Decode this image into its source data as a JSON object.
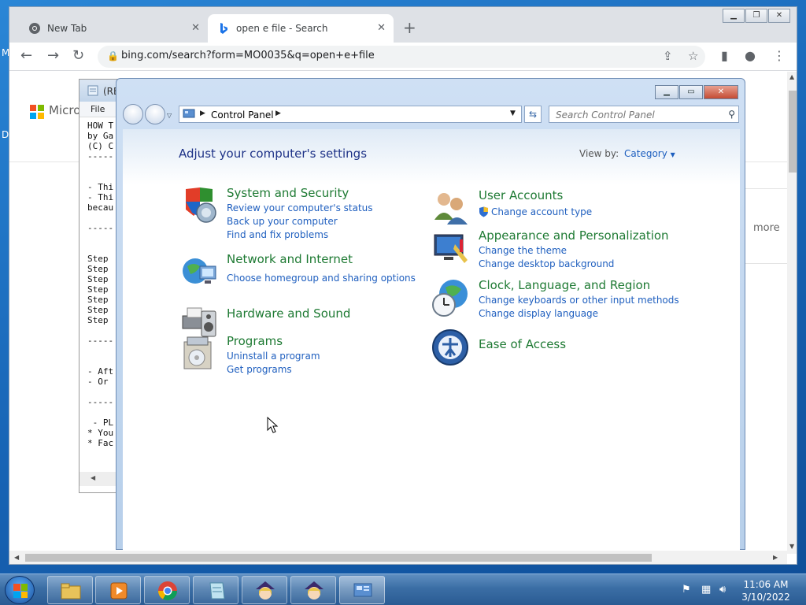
{
  "browser": {
    "tabs": [
      {
        "label": "New Tab",
        "active": false
      },
      {
        "label": "open e file - Search",
        "active": true
      }
    ],
    "url": "bing.com/search?form=MO0035&q=open+e+file",
    "page": {
      "logo_text": "Micros",
      "more_text": "more"
    }
  },
  "notepad": {
    "title": "(RE",
    "menu_file": "File",
    "lines": [
      "HOW T",
      "by Ga",
      "(C) C",
      "-----",
      "",
      "",
      "- Thi",
      "- Thi",
      "becau",
      "",
      "-----",
      "",
      "",
      "Step",
      "Step",
      "Step",
      "Step",
      "Step",
      "Step",
      "Step",
      "",
      "-----",
      "",
      "",
      "- Aft",
      "- Or",
      "",
      "-----",
      "",
      " - PL",
      "* You",
      "* Fac"
    ]
  },
  "control_panel": {
    "breadcrumb": "Control Panel",
    "search_placeholder": "Search Control Panel",
    "heading": "Adjust your computer's settings",
    "view_by_label": "View by:",
    "view_by_value": "Category",
    "categories": [
      {
        "title": "System and Security",
        "icon": "shield-icon",
        "links": [
          "Review your computer's status",
          "Back up your computer",
          "Find and fix problems"
        ]
      },
      {
        "title": "Network and Internet",
        "icon": "network-globe-icon",
        "links": [
          "Choose homegroup and sharing options"
        ]
      },
      {
        "title": "Hardware and Sound",
        "icon": "printer-speaker-icon",
        "links": []
      },
      {
        "title": "Programs",
        "icon": "programs-box-icon",
        "links": [
          "Uninstall a program",
          "Get programs"
        ]
      },
      {
        "title": "User Accounts",
        "icon": "users-icon",
        "links": [
          "Change account type"
        ]
      },
      {
        "title": "Appearance and Personalization",
        "icon": "monitor-palette-icon",
        "links": [
          "Change the theme",
          "Change desktop background"
        ]
      },
      {
        "title": "Clock, Language, and Region",
        "icon": "clock-globe-icon",
        "links": [
          "Change keyboards or other input methods",
          "Change display language"
        ]
      },
      {
        "title": "Ease of Access",
        "icon": "ease-of-access-icon",
        "links": []
      }
    ]
  },
  "taskbar": {
    "time": "11:06 AM",
    "date": "3/10/2022"
  },
  "colors": {
    "cp_link": "#1f5fbf",
    "cp_title": "#1e7a33",
    "cp_heading": "#1e3287"
  }
}
